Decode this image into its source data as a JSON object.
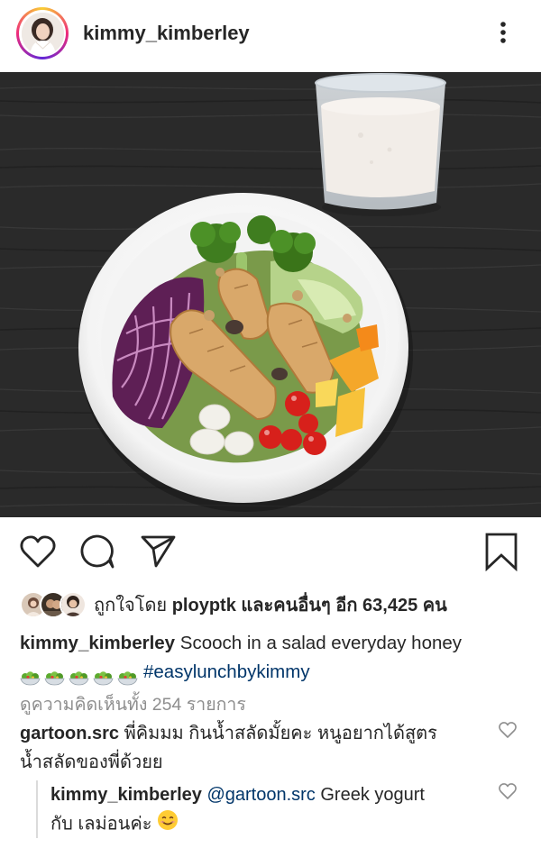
{
  "post": {
    "username": "kimmy_kimberley",
    "avatar_icon": "profile-avatar"
  },
  "likes": {
    "prefix": "ถูกใจโดย",
    "user": "ployptk",
    "mid": "และคนอื่นๆ อีก",
    "count": "63,425",
    "suffix": "คน"
  },
  "caption": {
    "username": "kimmy_kimberley",
    "text": "Scooch in a salad everyday honey",
    "emoji_icon": "salad-bowl-emoji",
    "emoji_count": 5,
    "hashtag": "#easylunchbykimmy"
  },
  "comments_link": "ดูความคิดเห็นทั้ง 254 รายการ",
  "comments": [
    {
      "username": "gartoon.src",
      "text_line1": "พี่คิมมม กินน้ำสลัดมั้ยคะ หนูอยากได้สูตร",
      "text_line2": "น้ำสลัดของพี่ด้วยย"
    },
    {
      "username": "kimmy_kimberley",
      "mention": "@gartoon.src",
      "text_line1": "Greek yogurt",
      "text_line2": "กับ เลม่อนค่ะ",
      "emoji_icon": "smiling-face-emoji"
    }
  ],
  "colors": {
    "text": "#262626",
    "secondary": "#8e8e8e",
    "link": "#003569",
    "table": "#2b2b2b"
  }
}
